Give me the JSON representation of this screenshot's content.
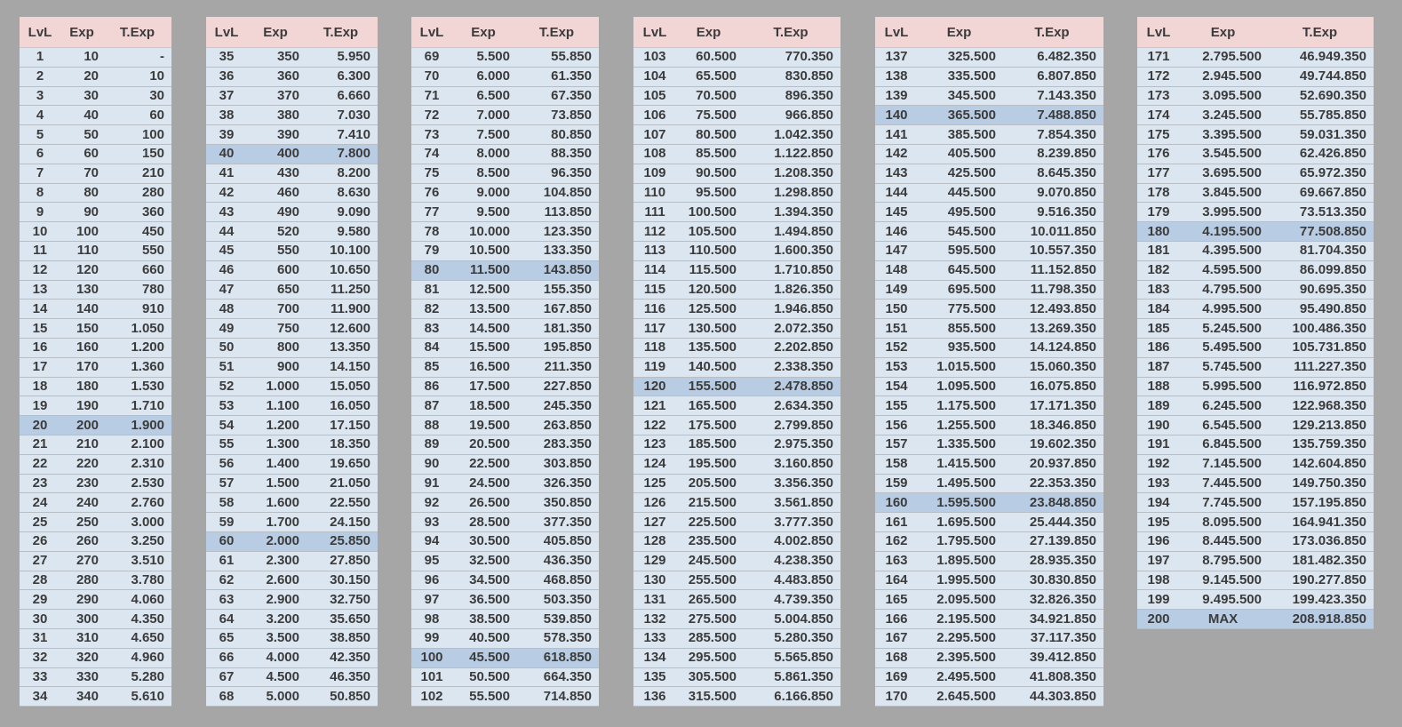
{
  "headers": [
    "LvL",
    "Exp",
    "T.Exp"
  ],
  "colors": {
    "header_bg": "#f2d5d5",
    "row_bg": "#dce6f1",
    "highlight_bg": "#b8cce4",
    "page_bg": "#a6a6a6"
  },
  "tables": [
    {
      "rows": [
        [
          "1",
          "10",
          "-"
        ],
        [
          "2",
          "20",
          "10"
        ],
        [
          "3",
          "30",
          "30"
        ],
        [
          "4",
          "40",
          "60"
        ],
        [
          "5",
          "50",
          "100"
        ],
        [
          "6",
          "60",
          "150"
        ],
        [
          "7",
          "70",
          "210"
        ],
        [
          "8",
          "80",
          "280"
        ],
        [
          "9",
          "90",
          "360"
        ],
        [
          "10",
          "100",
          "450"
        ],
        [
          "11",
          "110",
          "550"
        ],
        [
          "12",
          "120",
          "660"
        ],
        [
          "13",
          "130",
          "780"
        ],
        [
          "14",
          "140",
          "910"
        ],
        [
          "15",
          "150",
          "1.050"
        ],
        [
          "16",
          "160",
          "1.200"
        ],
        [
          "17",
          "170",
          "1.360"
        ],
        [
          "18",
          "180",
          "1.530"
        ],
        [
          "19",
          "190",
          "1.710"
        ],
        [
          "20",
          "200",
          "1.900"
        ],
        [
          "21",
          "210",
          "2.100"
        ],
        [
          "22",
          "220",
          "2.310"
        ],
        [
          "23",
          "230",
          "2.530"
        ],
        [
          "24",
          "240",
          "2.760"
        ],
        [
          "25",
          "250",
          "3.000"
        ],
        [
          "26",
          "260",
          "3.250"
        ],
        [
          "27",
          "270",
          "3.510"
        ],
        [
          "28",
          "280",
          "3.780"
        ],
        [
          "29",
          "290",
          "4.060"
        ],
        [
          "30",
          "300",
          "4.350"
        ],
        [
          "31",
          "310",
          "4.650"
        ],
        [
          "32",
          "320",
          "4.960"
        ],
        [
          "33",
          "330",
          "5.280"
        ],
        [
          "34",
          "340",
          "5.610"
        ]
      ],
      "highlight": [
        "20"
      ]
    },
    {
      "rows": [
        [
          "35",
          "350",
          "5.950"
        ],
        [
          "36",
          "360",
          "6.300"
        ],
        [
          "37",
          "370",
          "6.660"
        ],
        [
          "38",
          "380",
          "7.030"
        ],
        [
          "39",
          "390",
          "7.410"
        ],
        [
          "40",
          "400",
          "7.800"
        ],
        [
          "41",
          "430",
          "8.200"
        ],
        [
          "42",
          "460",
          "8.630"
        ],
        [
          "43",
          "490",
          "9.090"
        ],
        [
          "44",
          "520",
          "9.580"
        ],
        [
          "45",
          "550",
          "10.100"
        ],
        [
          "46",
          "600",
          "10.650"
        ],
        [
          "47",
          "650",
          "11.250"
        ],
        [
          "48",
          "700",
          "11.900"
        ],
        [
          "49",
          "750",
          "12.600"
        ],
        [
          "50",
          "800",
          "13.350"
        ],
        [
          "51",
          "900",
          "14.150"
        ],
        [
          "52",
          "1.000",
          "15.050"
        ],
        [
          "53",
          "1.100",
          "16.050"
        ],
        [
          "54",
          "1.200",
          "17.150"
        ],
        [
          "55",
          "1.300",
          "18.350"
        ],
        [
          "56",
          "1.400",
          "19.650"
        ],
        [
          "57",
          "1.500",
          "21.050"
        ],
        [
          "58",
          "1.600",
          "22.550"
        ],
        [
          "59",
          "1.700",
          "24.150"
        ],
        [
          "60",
          "2.000",
          "25.850"
        ],
        [
          "61",
          "2.300",
          "27.850"
        ],
        [
          "62",
          "2.600",
          "30.150"
        ],
        [
          "63",
          "2.900",
          "32.750"
        ],
        [
          "64",
          "3.200",
          "35.650"
        ],
        [
          "65",
          "3.500",
          "38.850"
        ],
        [
          "66",
          "4.000",
          "42.350"
        ],
        [
          "67",
          "4.500",
          "46.350"
        ],
        [
          "68",
          "5.000",
          "50.850"
        ]
      ],
      "highlight": [
        "40",
        "60"
      ]
    },
    {
      "rows": [
        [
          "69",
          "5.500",
          "55.850"
        ],
        [
          "70",
          "6.000",
          "61.350"
        ],
        [
          "71",
          "6.500",
          "67.350"
        ],
        [
          "72",
          "7.000",
          "73.850"
        ],
        [
          "73",
          "7.500",
          "80.850"
        ],
        [
          "74",
          "8.000",
          "88.350"
        ],
        [
          "75",
          "8.500",
          "96.350"
        ],
        [
          "76",
          "9.000",
          "104.850"
        ],
        [
          "77",
          "9.500",
          "113.850"
        ],
        [
          "78",
          "10.000",
          "123.350"
        ],
        [
          "79",
          "10.500",
          "133.350"
        ],
        [
          "80",
          "11.500",
          "143.850"
        ],
        [
          "81",
          "12.500",
          "155.350"
        ],
        [
          "82",
          "13.500",
          "167.850"
        ],
        [
          "83",
          "14.500",
          "181.350"
        ],
        [
          "84",
          "15.500",
          "195.850"
        ],
        [
          "85",
          "16.500",
          "211.350"
        ],
        [
          "86",
          "17.500",
          "227.850"
        ],
        [
          "87",
          "18.500",
          "245.350"
        ],
        [
          "88",
          "19.500",
          "263.850"
        ],
        [
          "89",
          "20.500",
          "283.350"
        ],
        [
          "90",
          "22.500",
          "303.850"
        ],
        [
          "91",
          "24.500",
          "326.350"
        ],
        [
          "92",
          "26.500",
          "350.850"
        ],
        [
          "93",
          "28.500",
          "377.350"
        ],
        [
          "94",
          "30.500",
          "405.850"
        ],
        [
          "95",
          "32.500",
          "436.350"
        ],
        [
          "96",
          "34.500",
          "468.850"
        ],
        [
          "97",
          "36.500",
          "503.350"
        ],
        [
          "98",
          "38.500",
          "539.850"
        ],
        [
          "99",
          "40.500",
          "578.350"
        ],
        [
          "100",
          "45.500",
          "618.850"
        ],
        [
          "101",
          "50.500",
          "664.350"
        ],
        [
          "102",
          "55.500",
          "714.850"
        ]
      ],
      "highlight": [
        "80",
        "100"
      ]
    },
    {
      "rows": [
        [
          "103",
          "60.500",
          "770.350"
        ],
        [
          "104",
          "65.500",
          "830.850"
        ],
        [
          "105",
          "70.500",
          "896.350"
        ],
        [
          "106",
          "75.500",
          "966.850"
        ],
        [
          "107",
          "80.500",
          "1.042.350"
        ],
        [
          "108",
          "85.500",
          "1.122.850"
        ],
        [
          "109",
          "90.500",
          "1.208.350"
        ],
        [
          "110",
          "95.500",
          "1.298.850"
        ],
        [
          "111",
          "100.500",
          "1.394.350"
        ],
        [
          "112",
          "105.500",
          "1.494.850"
        ],
        [
          "113",
          "110.500",
          "1.600.350"
        ],
        [
          "114",
          "115.500",
          "1.710.850"
        ],
        [
          "115",
          "120.500",
          "1.826.350"
        ],
        [
          "116",
          "125.500",
          "1.946.850"
        ],
        [
          "117",
          "130.500",
          "2.072.350"
        ],
        [
          "118",
          "135.500",
          "2.202.850"
        ],
        [
          "119",
          "140.500",
          "2.338.350"
        ],
        [
          "120",
          "155.500",
          "2.478.850"
        ],
        [
          "121",
          "165.500",
          "2.634.350"
        ],
        [
          "122",
          "175.500",
          "2.799.850"
        ],
        [
          "123",
          "185.500",
          "2.975.350"
        ],
        [
          "124",
          "195.500",
          "3.160.850"
        ],
        [
          "125",
          "205.500",
          "3.356.350"
        ],
        [
          "126",
          "215.500",
          "3.561.850"
        ],
        [
          "127",
          "225.500",
          "3.777.350"
        ],
        [
          "128",
          "235.500",
          "4.002.850"
        ],
        [
          "129",
          "245.500",
          "4.238.350"
        ],
        [
          "130",
          "255.500",
          "4.483.850"
        ],
        [
          "131",
          "265.500",
          "4.739.350"
        ],
        [
          "132",
          "275.500",
          "5.004.850"
        ],
        [
          "133",
          "285.500",
          "5.280.350"
        ],
        [
          "134",
          "295.500",
          "5.565.850"
        ],
        [
          "135",
          "305.500",
          "5.861.350"
        ],
        [
          "136",
          "315.500",
          "6.166.850"
        ]
      ],
      "highlight": [
        "120"
      ]
    },
    {
      "rows": [
        [
          "137",
          "325.500",
          "6.482.350"
        ],
        [
          "138",
          "335.500",
          "6.807.850"
        ],
        [
          "139",
          "345.500",
          "7.143.350"
        ],
        [
          "140",
          "365.500",
          "7.488.850"
        ],
        [
          "141",
          "385.500",
          "7.854.350"
        ],
        [
          "142",
          "405.500",
          "8.239.850"
        ],
        [
          "143",
          "425.500",
          "8.645.350"
        ],
        [
          "144",
          "445.500",
          "9.070.850"
        ],
        [
          "145",
          "495.500",
          "9.516.350"
        ],
        [
          "146",
          "545.500",
          "10.011.850"
        ],
        [
          "147",
          "595.500",
          "10.557.350"
        ],
        [
          "148",
          "645.500",
          "11.152.850"
        ],
        [
          "149",
          "695.500",
          "11.798.350"
        ],
        [
          "150",
          "775.500",
          "12.493.850"
        ],
        [
          "151",
          "855.500",
          "13.269.350"
        ],
        [
          "152",
          "935.500",
          "14.124.850"
        ],
        [
          "153",
          "1.015.500",
          "15.060.350"
        ],
        [
          "154",
          "1.095.500",
          "16.075.850"
        ],
        [
          "155",
          "1.175.500",
          "17.171.350"
        ],
        [
          "156",
          "1.255.500",
          "18.346.850"
        ],
        [
          "157",
          "1.335.500",
          "19.602.350"
        ],
        [
          "158",
          "1.415.500",
          "20.937.850"
        ],
        [
          "159",
          "1.495.500",
          "22.353.350"
        ],
        [
          "160",
          "1.595.500",
          "23.848.850"
        ],
        [
          "161",
          "1.695.500",
          "25.444.350"
        ],
        [
          "162",
          "1.795.500",
          "27.139.850"
        ],
        [
          "163",
          "1.895.500",
          "28.935.350"
        ],
        [
          "164",
          "1.995.500",
          "30.830.850"
        ],
        [
          "165",
          "2.095.500",
          "32.826.350"
        ],
        [
          "166",
          "2.195.500",
          "34.921.850"
        ],
        [
          "167",
          "2.295.500",
          "37.117.350"
        ],
        [
          "168",
          "2.395.500",
          "39.412.850"
        ],
        [
          "169",
          "2.495.500",
          "41.808.350"
        ],
        [
          "170",
          "2.645.500",
          "44.303.850"
        ]
      ],
      "highlight": [
        "140",
        "160"
      ]
    },
    {
      "rows": [
        [
          "171",
          "2.795.500",
          "46.949.350"
        ],
        [
          "172",
          "2.945.500",
          "49.744.850"
        ],
        [
          "173",
          "3.095.500",
          "52.690.350"
        ],
        [
          "174",
          "3.245.500",
          "55.785.850"
        ],
        [
          "175",
          "3.395.500",
          "59.031.350"
        ],
        [
          "176",
          "3.545.500",
          "62.426.850"
        ],
        [
          "177",
          "3.695.500",
          "65.972.350"
        ],
        [
          "178",
          "3.845.500",
          "69.667.850"
        ],
        [
          "179",
          "3.995.500",
          "73.513.350"
        ],
        [
          "180",
          "4.195.500",
          "77.508.850"
        ],
        [
          "181",
          "4.395.500",
          "81.704.350"
        ],
        [
          "182",
          "4.595.500",
          "86.099.850"
        ],
        [
          "183",
          "4.795.500",
          "90.695.350"
        ],
        [
          "184",
          "4.995.500",
          "95.490.850"
        ],
        [
          "185",
          "5.245.500",
          "100.486.350"
        ],
        [
          "186",
          "5.495.500",
          "105.731.850"
        ],
        [
          "187",
          "5.745.500",
          "111.227.350"
        ],
        [
          "188",
          "5.995.500",
          "116.972.850"
        ],
        [
          "189",
          "6.245.500",
          "122.968.350"
        ],
        [
          "190",
          "6.545.500",
          "129.213.850"
        ],
        [
          "191",
          "6.845.500",
          "135.759.350"
        ],
        [
          "192",
          "7.145.500",
          "142.604.850"
        ],
        [
          "193",
          "7.445.500",
          "149.750.350"
        ],
        [
          "194",
          "7.745.500",
          "157.195.850"
        ],
        [
          "195",
          "8.095.500",
          "164.941.350"
        ],
        [
          "196",
          "8.445.500",
          "173.036.850"
        ],
        [
          "197",
          "8.795.500",
          "181.482.350"
        ],
        [
          "198",
          "9.145.500",
          "190.277.850"
        ],
        [
          "199",
          "9.495.500",
          "199.423.350"
        ],
        [
          "200",
          "MAX",
          "208.918.850"
        ]
      ],
      "highlight": [
        "180",
        "200"
      ]
    }
  ]
}
